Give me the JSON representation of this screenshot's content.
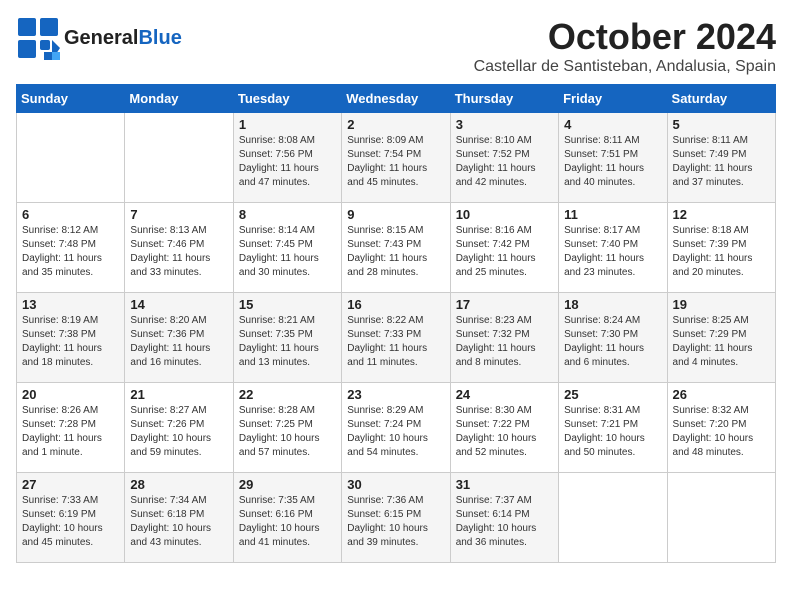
{
  "header": {
    "logo_line1": "General",
    "logo_line2": "Blue",
    "month": "October 2024",
    "location": "Castellar de Santisteban, Andalusia, Spain"
  },
  "weekdays": [
    "Sunday",
    "Monday",
    "Tuesday",
    "Wednesday",
    "Thursday",
    "Friday",
    "Saturday"
  ],
  "weeks": [
    [
      {
        "day": "",
        "detail": ""
      },
      {
        "day": "",
        "detail": ""
      },
      {
        "day": "1",
        "detail": "Sunrise: 8:08 AM\nSunset: 7:56 PM\nDaylight: 11 hours and 47 minutes."
      },
      {
        "day": "2",
        "detail": "Sunrise: 8:09 AM\nSunset: 7:54 PM\nDaylight: 11 hours and 45 minutes."
      },
      {
        "day": "3",
        "detail": "Sunrise: 8:10 AM\nSunset: 7:52 PM\nDaylight: 11 hours and 42 minutes."
      },
      {
        "day": "4",
        "detail": "Sunrise: 8:11 AM\nSunset: 7:51 PM\nDaylight: 11 hours and 40 minutes."
      },
      {
        "day": "5",
        "detail": "Sunrise: 8:11 AM\nSunset: 7:49 PM\nDaylight: 11 hours and 37 minutes."
      }
    ],
    [
      {
        "day": "6",
        "detail": "Sunrise: 8:12 AM\nSunset: 7:48 PM\nDaylight: 11 hours and 35 minutes."
      },
      {
        "day": "7",
        "detail": "Sunrise: 8:13 AM\nSunset: 7:46 PM\nDaylight: 11 hours and 33 minutes."
      },
      {
        "day": "8",
        "detail": "Sunrise: 8:14 AM\nSunset: 7:45 PM\nDaylight: 11 hours and 30 minutes."
      },
      {
        "day": "9",
        "detail": "Sunrise: 8:15 AM\nSunset: 7:43 PM\nDaylight: 11 hours and 28 minutes."
      },
      {
        "day": "10",
        "detail": "Sunrise: 8:16 AM\nSunset: 7:42 PM\nDaylight: 11 hours and 25 minutes."
      },
      {
        "day": "11",
        "detail": "Sunrise: 8:17 AM\nSunset: 7:40 PM\nDaylight: 11 hours and 23 minutes."
      },
      {
        "day": "12",
        "detail": "Sunrise: 8:18 AM\nSunset: 7:39 PM\nDaylight: 11 hours and 20 minutes."
      }
    ],
    [
      {
        "day": "13",
        "detail": "Sunrise: 8:19 AM\nSunset: 7:38 PM\nDaylight: 11 hours and 18 minutes."
      },
      {
        "day": "14",
        "detail": "Sunrise: 8:20 AM\nSunset: 7:36 PM\nDaylight: 11 hours and 16 minutes."
      },
      {
        "day": "15",
        "detail": "Sunrise: 8:21 AM\nSunset: 7:35 PM\nDaylight: 11 hours and 13 minutes."
      },
      {
        "day": "16",
        "detail": "Sunrise: 8:22 AM\nSunset: 7:33 PM\nDaylight: 11 hours and 11 minutes."
      },
      {
        "day": "17",
        "detail": "Sunrise: 8:23 AM\nSunset: 7:32 PM\nDaylight: 11 hours and 8 minutes."
      },
      {
        "day": "18",
        "detail": "Sunrise: 8:24 AM\nSunset: 7:30 PM\nDaylight: 11 hours and 6 minutes."
      },
      {
        "day": "19",
        "detail": "Sunrise: 8:25 AM\nSunset: 7:29 PM\nDaylight: 11 hours and 4 minutes."
      }
    ],
    [
      {
        "day": "20",
        "detail": "Sunrise: 8:26 AM\nSunset: 7:28 PM\nDaylight: 11 hours and 1 minute."
      },
      {
        "day": "21",
        "detail": "Sunrise: 8:27 AM\nSunset: 7:26 PM\nDaylight: 10 hours and 59 minutes."
      },
      {
        "day": "22",
        "detail": "Sunrise: 8:28 AM\nSunset: 7:25 PM\nDaylight: 10 hours and 57 minutes."
      },
      {
        "day": "23",
        "detail": "Sunrise: 8:29 AM\nSunset: 7:24 PM\nDaylight: 10 hours and 54 minutes."
      },
      {
        "day": "24",
        "detail": "Sunrise: 8:30 AM\nSunset: 7:22 PM\nDaylight: 10 hours and 52 minutes."
      },
      {
        "day": "25",
        "detail": "Sunrise: 8:31 AM\nSunset: 7:21 PM\nDaylight: 10 hours and 50 minutes."
      },
      {
        "day": "26",
        "detail": "Sunrise: 8:32 AM\nSunset: 7:20 PM\nDaylight: 10 hours and 48 minutes."
      }
    ],
    [
      {
        "day": "27",
        "detail": "Sunrise: 7:33 AM\nSunset: 6:19 PM\nDaylight: 10 hours and 45 minutes."
      },
      {
        "day": "28",
        "detail": "Sunrise: 7:34 AM\nSunset: 6:18 PM\nDaylight: 10 hours and 43 minutes."
      },
      {
        "day": "29",
        "detail": "Sunrise: 7:35 AM\nSunset: 6:16 PM\nDaylight: 10 hours and 41 minutes."
      },
      {
        "day": "30",
        "detail": "Sunrise: 7:36 AM\nSunset: 6:15 PM\nDaylight: 10 hours and 39 minutes."
      },
      {
        "day": "31",
        "detail": "Sunrise: 7:37 AM\nSunset: 6:14 PM\nDaylight: 10 hours and 36 minutes."
      },
      {
        "day": "",
        "detail": ""
      },
      {
        "day": "",
        "detail": ""
      }
    ]
  ]
}
